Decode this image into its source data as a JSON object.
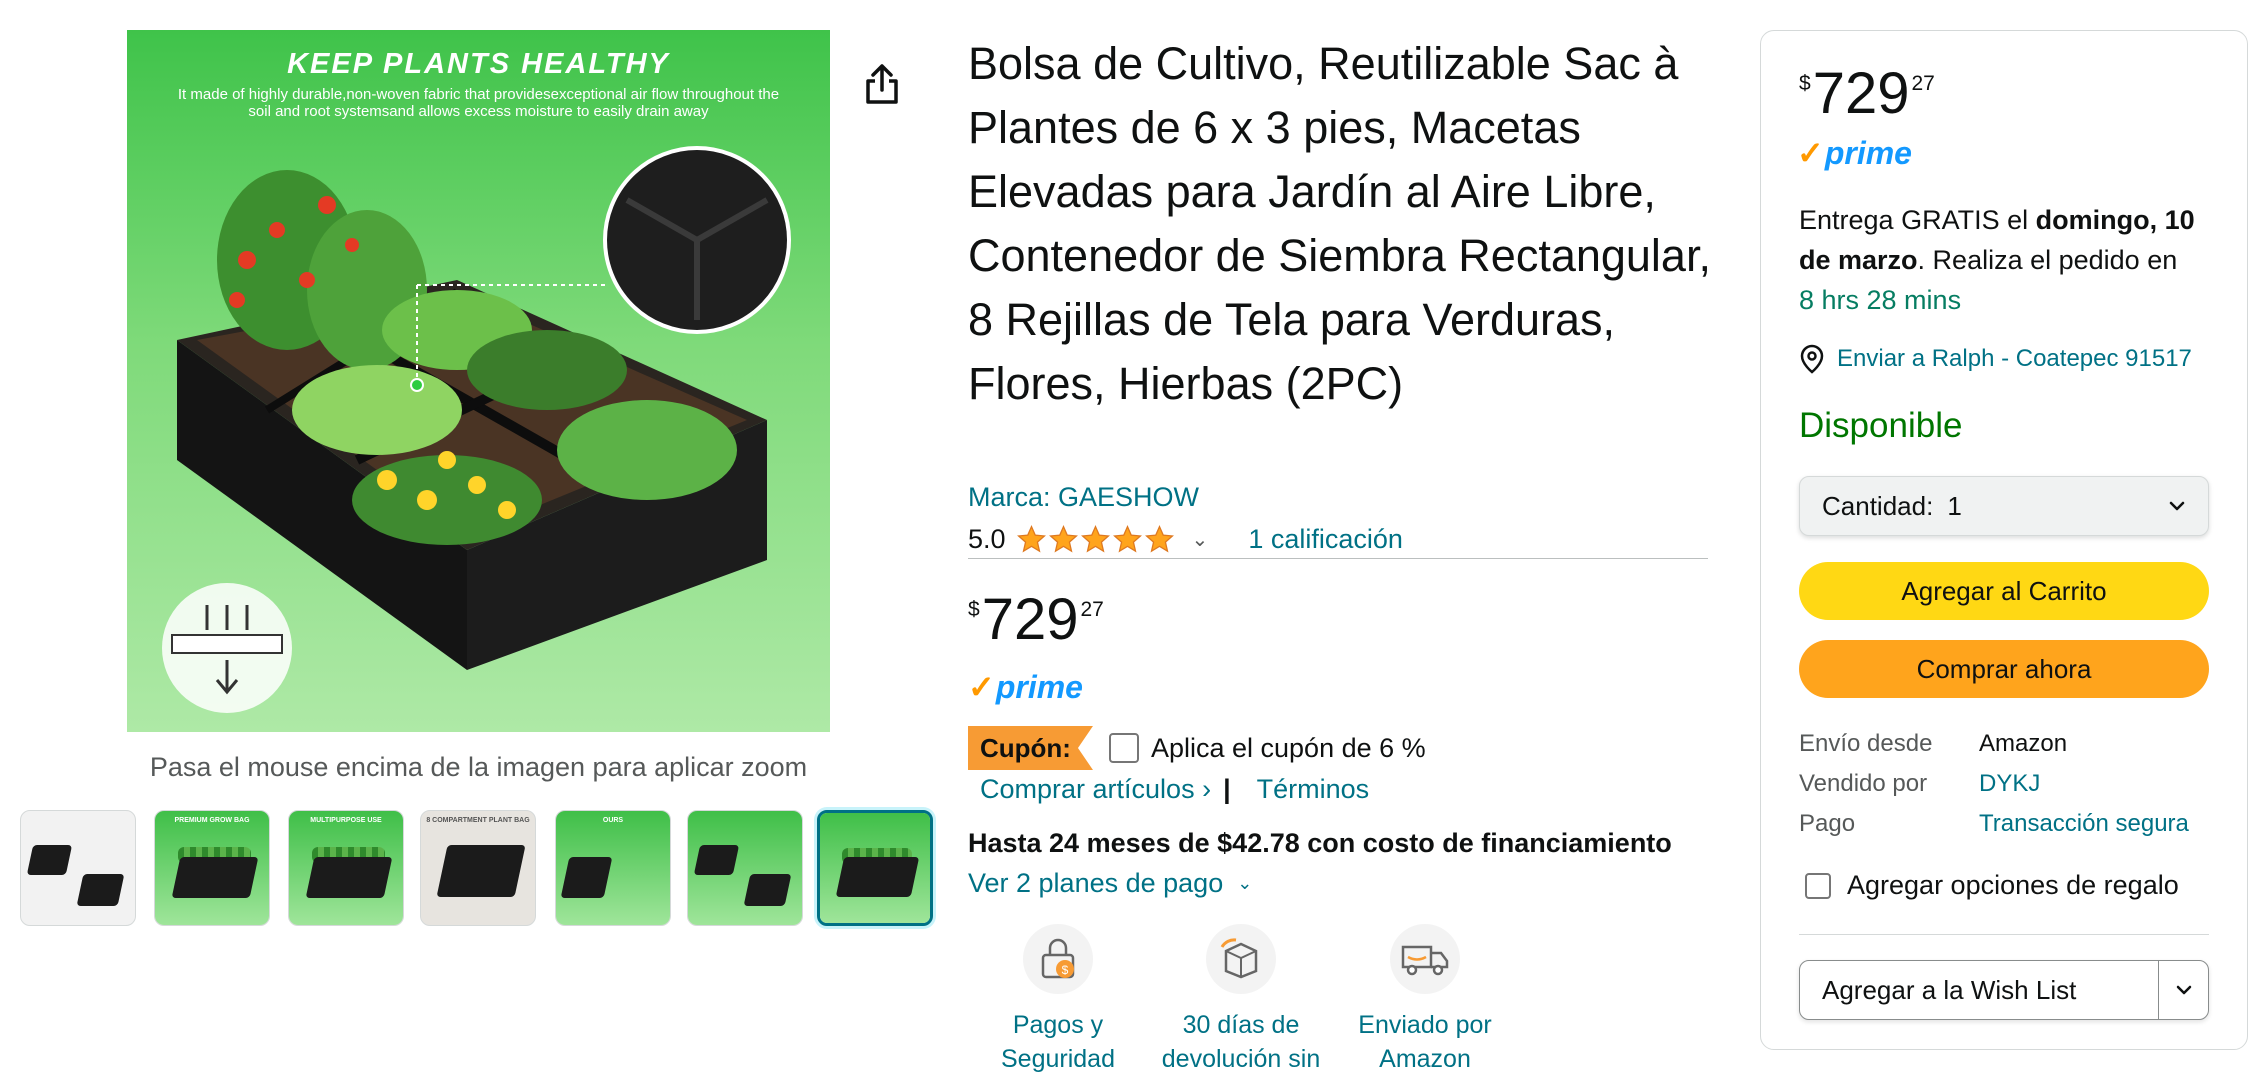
{
  "gallery": {
    "main_image": {
      "headline": "KEEP PLANTS HEALTHY",
      "subline": "It made of highly durable,non-woven fabric that providesexceptional air flow throughout the soil and root systemsand allows excess moisture to easily drain away"
    },
    "zoom_hint": "Pasa el mouse encima de la imagen para aplicar zoom",
    "thumbnails": [
      {
        "label": ""
      },
      {
        "label": "PREMIUM GROW BAG"
      },
      {
        "label": "MULTIPURPOSE USE"
      },
      {
        "label": "8 COMPARTMENT PLANT BAG"
      },
      {
        "label": "OURS"
      },
      {
        "label": ""
      },
      {
        "label": ""
      }
    ],
    "selected_thumbnail": 6
  },
  "product": {
    "title": "Bolsa de Cultivo, Reutilizable Sac à Plantes de 6 x 3 pies, Macetas Elevadas para Jardín al Aire Libre, Contenedor de Siembra Rectangular, 8 Rejillas de Tela para Verduras, Flores, Hierbas (2PC)",
    "brand": "Marca: GAESHOW",
    "rating": "5.0",
    "stars": 5,
    "ratings_count": "1 calificación",
    "price": {
      "symbol": "$",
      "whole": "729",
      "fraction": "27"
    },
    "prime_label": "prime",
    "coupon": {
      "badge": "Cupón:",
      "text": "Aplica el cupón de 6 %",
      "shop_link": "Comprar artículos ›",
      "separator": "|",
      "terms_link": "Términos"
    },
    "financing": "Hasta 24 meses de $42.78 con costo de financiamiento",
    "plans_link": "Ver 2 planes de pago",
    "trust_badges": [
      {
        "icon": "secure-payment-icon",
        "label_line1": "Pagos y",
        "label_line2": "Seguridad"
      },
      {
        "icon": "return-box-icon",
        "label_line1": "30 días de",
        "label_line2": "devolución sin"
      },
      {
        "icon": "amazon-delivery-icon",
        "label_line1": "Enviado por",
        "label_line2": "Amazon"
      }
    ]
  },
  "buybox": {
    "price": {
      "symbol": "$",
      "whole": "729",
      "fraction": "27"
    },
    "prime_label": "prime",
    "delivery": {
      "prefix": "Entrega GRATIS el ",
      "date": "domingo, 10 de marzo",
      "suffix": ". Realiza el pedido en ",
      "timer": "8 hrs 28 mins"
    },
    "ship_to": "Enviar a Ralph - Coatepec 91517",
    "availability": "Disponible",
    "quantity": {
      "label": "Cantidad:",
      "value": "1"
    },
    "add_to_cart": "Agregar al Carrito",
    "buy_now": "Comprar ahora",
    "info": [
      {
        "key": "Envío desde",
        "value": "Amazon",
        "link": false
      },
      {
        "key": "Vendido por",
        "value": "DYKJ",
        "link": true
      },
      {
        "key": "Pago",
        "value": "Transacción segura",
        "link": true
      }
    ],
    "gift_option": "Agregar opciones de regalo",
    "wishlist": "Agregar a la Wish List"
  },
  "colors": {
    "link": "#007185",
    "price_text": "#0f1111",
    "prime_blue": "#1399ff",
    "prime_check": "#ff9900",
    "in_stock": "#007600",
    "timer_green": "#067d62",
    "cart_button": "#ffd814",
    "buy_button": "#ffa41c",
    "coupon_badge": "#f79b34",
    "star": "#ffa41c"
  }
}
